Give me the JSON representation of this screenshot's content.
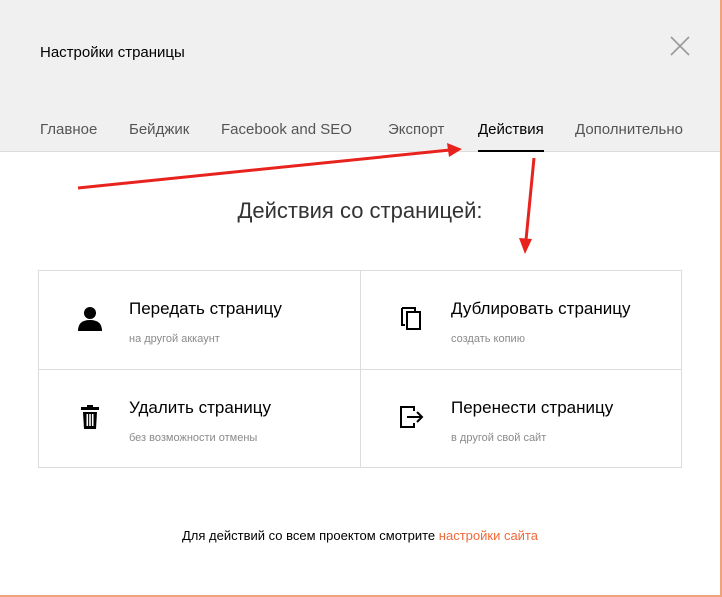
{
  "dialog": {
    "title": "Настройки страницы",
    "close_icon": "close-icon"
  },
  "tabs": [
    {
      "label": "Главное",
      "active": false
    },
    {
      "label": "Бейджик",
      "active": false
    },
    {
      "label": "Facebook and SEO",
      "active": false
    },
    {
      "label": "Экспорт",
      "active": false
    },
    {
      "label": "Действия",
      "active": true
    },
    {
      "label": "Дополнительно",
      "active": false
    }
  ],
  "main": {
    "heading": "Действия со страницей:",
    "actions": [
      {
        "title": "Передать страницу",
        "subtitle": "на другой аккаунт",
        "icon": "user-icon"
      },
      {
        "title": "Дублировать страницу",
        "subtitle": "создать копию",
        "icon": "copy-icon"
      },
      {
        "title": "Удалить страницу",
        "subtitle": "без возможности отмены",
        "icon": "trash-icon"
      },
      {
        "title": "Перенести страницу",
        "subtitle": "в другой свой сайт",
        "icon": "move-icon"
      }
    ]
  },
  "footer": {
    "text": "Для действий со всем проектом смотрите",
    "link": "настройки сайта"
  },
  "colors": {
    "accent": "#f06a3a",
    "annotation_arrow": "#e8231e",
    "header_bg": "#f0f0f0",
    "border": "#dcdcdc"
  }
}
